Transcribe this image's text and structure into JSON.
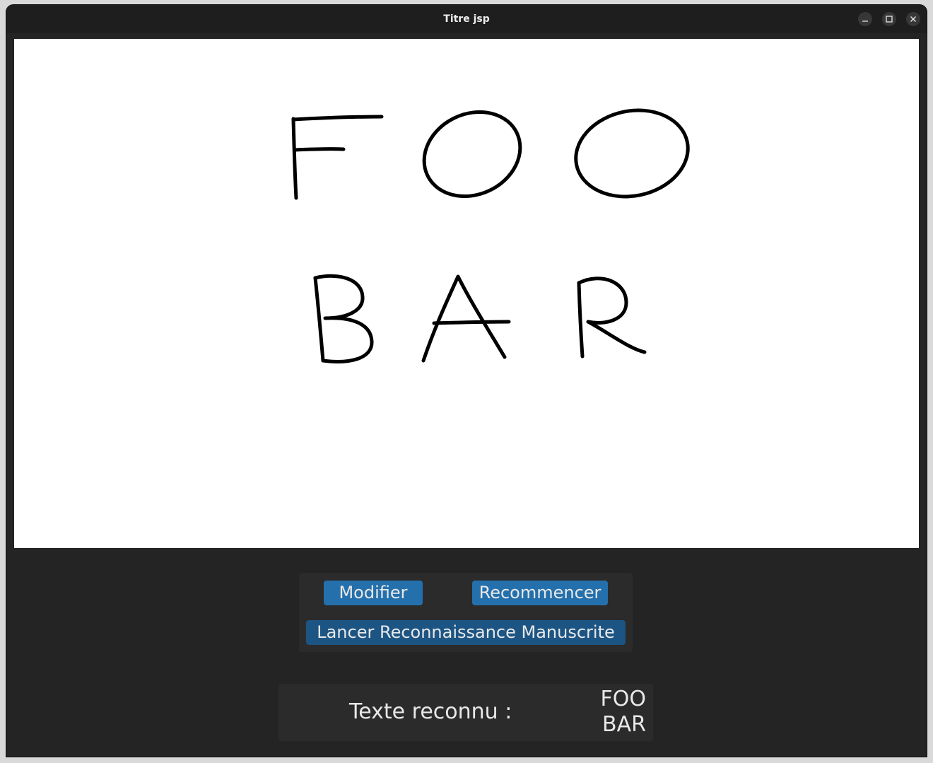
{
  "window": {
    "title": "Titre jsp",
    "controls": [
      "minimize-icon",
      "maximize-icon",
      "close-icon"
    ]
  },
  "canvas": {
    "handwritten_lines": [
      "FOO",
      "BAR"
    ],
    "ink_color": "#000000",
    "background": "#ffffff"
  },
  "controls": {
    "modifier_label": "Modifier",
    "recommencer_label": "Recommencer",
    "lancer_label": "Lancer Reconnaissance Manuscrite"
  },
  "result": {
    "label": "Texte reconnu :",
    "value": "FOO\nBAR"
  },
  "colors": {
    "window_bg": "#242424",
    "titlebar_bg": "#1e1e1e",
    "button_primary": "#2470ad",
    "button_secondary": "#1c5584",
    "panel_bg": "#2b2b2b",
    "text": "#e8e8e8"
  }
}
